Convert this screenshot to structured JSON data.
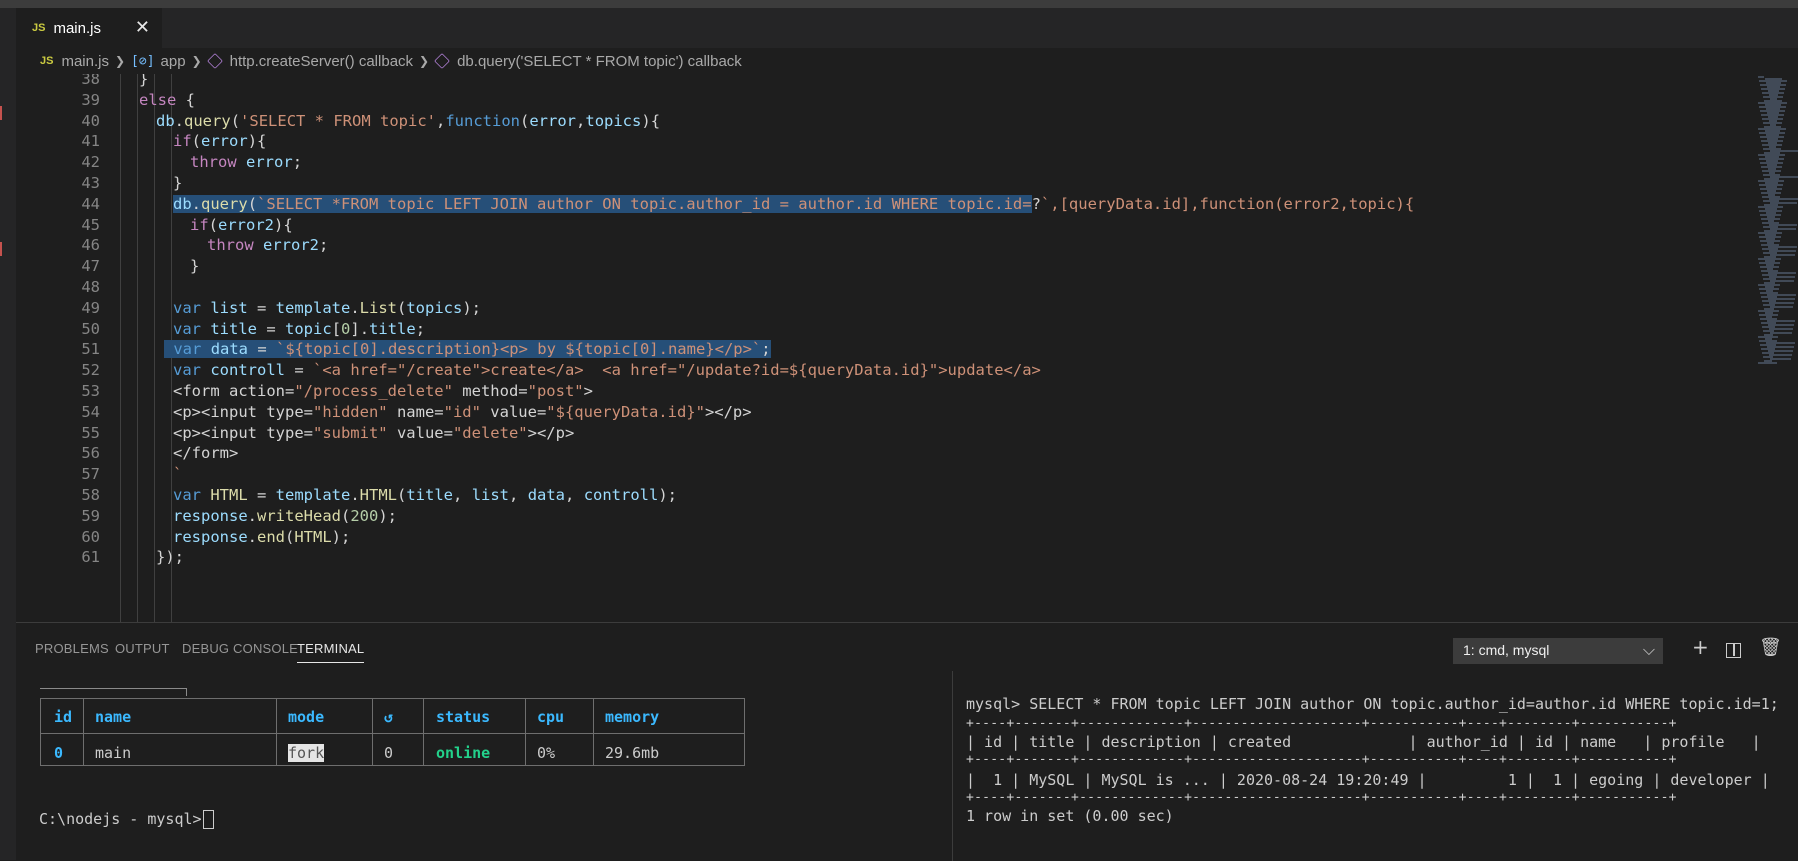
{
  "tab": {
    "icon": "JS",
    "title": "main.js"
  },
  "breadcrumb": {
    "file": "main.js",
    "app": "app",
    "callback1": "http.createServer() callback",
    "callback2": "db.query('SELECT * FROM topic') callback"
  },
  "editor": {
    "lines": [
      {
        "n": "38",
        "code": "}"
      },
      {
        "n": "39",
        "code": "else {"
      },
      {
        "n": "40",
        "code": "db.query('SELECT * FROM topic',function(error,topics){"
      },
      {
        "n": "41",
        "code": "if(error){"
      },
      {
        "n": "42",
        "code": "throw error;"
      },
      {
        "n": "43",
        "code": "}"
      },
      {
        "n": "44",
        "code": "db.query(`SELECT *FROM topic LEFT JOIN author ON topic.author_id = author.id WHERE topic.id=?`,[queryData.id],function(error2,topic){"
      },
      {
        "n": "45",
        "code": "if(error2){"
      },
      {
        "n": "46",
        "code": "throw error2;"
      },
      {
        "n": "47",
        "code": "}"
      },
      {
        "n": "48",
        "code": ""
      },
      {
        "n": "49",
        "code": "var list = template.List(topics);"
      },
      {
        "n": "50",
        "code": "var title = topic[0].title;"
      },
      {
        "n": "51",
        "code": "var data = `${topic[0].description}<p> by ${topic[0].name}</p>`;"
      },
      {
        "n": "52",
        "code": "var controll = `<a href=\"/create\">create</a>  <a href=\"/update?id=${queryData.id}\">update</a>"
      },
      {
        "n": "53",
        "code": "<form action=\"/process_delete\" method=\"post\">"
      },
      {
        "n": "54",
        "code": "<p><input type=\"hidden\" name=\"id\" value=\"${queryData.id}\"></p>"
      },
      {
        "n": "55",
        "code": "<p><input type=\"submit\" value=\"delete\"></p>"
      },
      {
        "n": "56",
        "code": "</form>"
      },
      {
        "n": "57",
        "code": "`"
      },
      {
        "n": "58",
        "code": "var HTML = template.HTML(title, list, data, controll);"
      },
      {
        "n": "59",
        "code": "response.writeHead(200);"
      },
      {
        "n": "60",
        "code": "response.end(HTML);"
      },
      {
        "n": "61",
        "code": "});"
      }
    ]
  },
  "panel": {
    "tabs": [
      "PROBLEMS",
      "OUTPUT",
      "DEBUG CONSOLE",
      "TERMINAL"
    ],
    "active_tab": "TERMINAL",
    "terminal_select": "1: cmd, mysql"
  },
  "pm2": {
    "headers": [
      "id",
      "name",
      "mode",
      "↺",
      "status",
      "cpu",
      "memory"
    ],
    "row": [
      "0",
      "main",
      "fork",
      "0",
      "online",
      "0%",
      "29.6mb"
    ]
  },
  "terminal_left": {
    "prompt": "C:\\nodejs - mysql>"
  },
  "terminal_right": {
    "query": "mysql> SELECT * FROM topic LEFT JOIN author ON topic.author_id=author.id WHERE topic.id=1;",
    "border": "+----+-------+-------------+---------------------+-----------+----+--------+-----------+",
    "header": "| id | title | description | created             | author_id | id | name   | profile   |",
    "row": "|  1 | MySQL | MySQL is ... | 2020-08-24 19:20:49 |         1 |  1 | egoing | developer |",
    "footer": "1 row in set (0.00 sec)"
  },
  "colors": {
    "editor_bg": "#1e1e1e",
    "keyword": "#569cd6",
    "control": "#c586c0",
    "function": "#dcdcaa",
    "string": "#ce9178",
    "variable": "#9cdcfe",
    "selection": "#264f78",
    "pm2_header": "#3bb9ff",
    "pm2_online": "#23d18b"
  }
}
